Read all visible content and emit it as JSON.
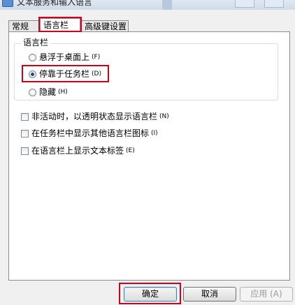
{
  "window": {
    "title": "文本服务和输入语言"
  },
  "tabs": [
    {
      "label": "常规"
    },
    {
      "label": "语言栏"
    },
    {
      "label": "高级键设置"
    }
  ],
  "language_bar": {
    "group_label": "语言栏",
    "options": [
      {
        "label": "悬浮于桌面上",
        "shortcut": "(F)",
        "checked": false
      },
      {
        "label": "停靠于任务栏",
        "shortcut": "(D)",
        "checked": true
      },
      {
        "label": "隐藏",
        "shortcut": "(H)",
        "checked": false
      }
    ]
  },
  "checkboxes": [
    {
      "label": "非活动时，以透明状态显示语言栏",
      "shortcut": "(N)",
      "checked": false
    },
    {
      "label": "在任务栏中显示其他语言栏图标",
      "shortcut": "(I)",
      "checked": false
    },
    {
      "label": "在语言栏上显示文本标签",
      "shortcut": "(E)",
      "checked": false
    }
  ],
  "buttons": {
    "ok": "确定",
    "cancel": "取消",
    "apply": "应用 (A)"
  },
  "colors": {
    "highlight": "#d0021b"
  }
}
